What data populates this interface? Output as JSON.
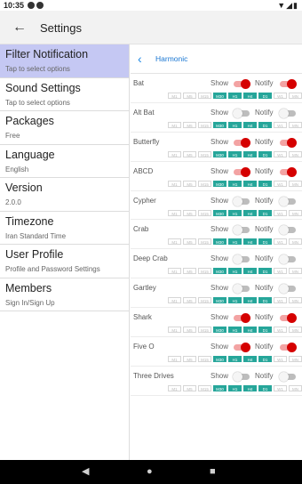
{
  "status": {
    "time": "10:35",
    "right_icons": "▼◢▮"
  },
  "appbar": {
    "title": "Settings",
    "back_glyph": "←"
  },
  "sidebar": {
    "items": [
      {
        "label": "Filter Notification",
        "sub": "Tap to select options",
        "active": true
      },
      {
        "label": "Sound Settings",
        "sub": "Tap to select options",
        "active": false
      },
      {
        "label": "Packages",
        "sub": "Free",
        "active": false
      },
      {
        "label": "Language",
        "sub": "English",
        "active": false
      },
      {
        "label": "Version",
        "sub": "2.0.0",
        "active": false
      },
      {
        "label": "Timezone",
        "sub": "Iran Standard Time",
        "active": false
      },
      {
        "label": "User Profile",
        "sub": "Profile and Password Settings",
        "active": false
      },
      {
        "label": "Members",
        "sub": "Sign In/Sign Up",
        "active": false
      }
    ]
  },
  "detail": {
    "back_glyph": "‹",
    "title": "Harmonic",
    "show_label": "Show",
    "notify_label": "Notify",
    "timeframes": [
      "M1",
      "M5",
      "M15",
      "M30",
      "H1",
      "H4",
      "D1",
      "W1",
      "MN"
    ],
    "patterns": [
      {
        "name": "Bat",
        "show": true,
        "notify": true,
        "active_tf": [
          "M30",
          "H1",
          "H4",
          "D1"
        ]
      },
      {
        "name": "Alt Bat",
        "show": false,
        "notify": false,
        "active_tf": [
          "M30",
          "H1",
          "H4",
          "D1"
        ]
      },
      {
        "name": "Butterfly",
        "show": true,
        "notify": true,
        "active_tf": [
          "M30",
          "H1",
          "H4",
          "D1"
        ]
      },
      {
        "name": "ABCD",
        "show": true,
        "notify": true,
        "active_tf": [
          "M30",
          "H1",
          "H4",
          "D1"
        ]
      },
      {
        "name": "Cypher",
        "show": false,
        "notify": false,
        "active_tf": [
          "M30",
          "H1",
          "H4",
          "D1"
        ]
      },
      {
        "name": "Crab",
        "show": false,
        "notify": false,
        "active_tf": [
          "M30",
          "H1",
          "H4",
          "D1"
        ]
      },
      {
        "name": "Deep Crab",
        "show": false,
        "notify": false,
        "active_tf": [
          "M30",
          "H1",
          "H4",
          "D1"
        ]
      },
      {
        "name": "Gartley",
        "show": false,
        "notify": false,
        "active_tf": [
          "M30",
          "H1",
          "H4",
          "D1"
        ]
      },
      {
        "name": "Shark",
        "show": true,
        "notify": true,
        "active_tf": [
          "M30",
          "H1",
          "H4",
          "D1"
        ]
      },
      {
        "name": "Five O",
        "show": true,
        "notify": true,
        "active_tf": [
          "M30",
          "H1",
          "H4",
          "D1"
        ]
      },
      {
        "name": "Three Drives",
        "show": false,
        "notify": false,
        "active_tf": [
          "M30",
          "H1",
          "H4",
          "D1"
        ]
      }
    ]
  },
  "navbar": {
    "back": "◀",
    "home": "●",
    "recent": "■"
  },
  "colors": {
    "active_bg": "#c5c8f3",
    "toggle_on": "#d50000",
    "timeframe_on": "#26a69a",
    "link": "#1976d2"
  }
}
